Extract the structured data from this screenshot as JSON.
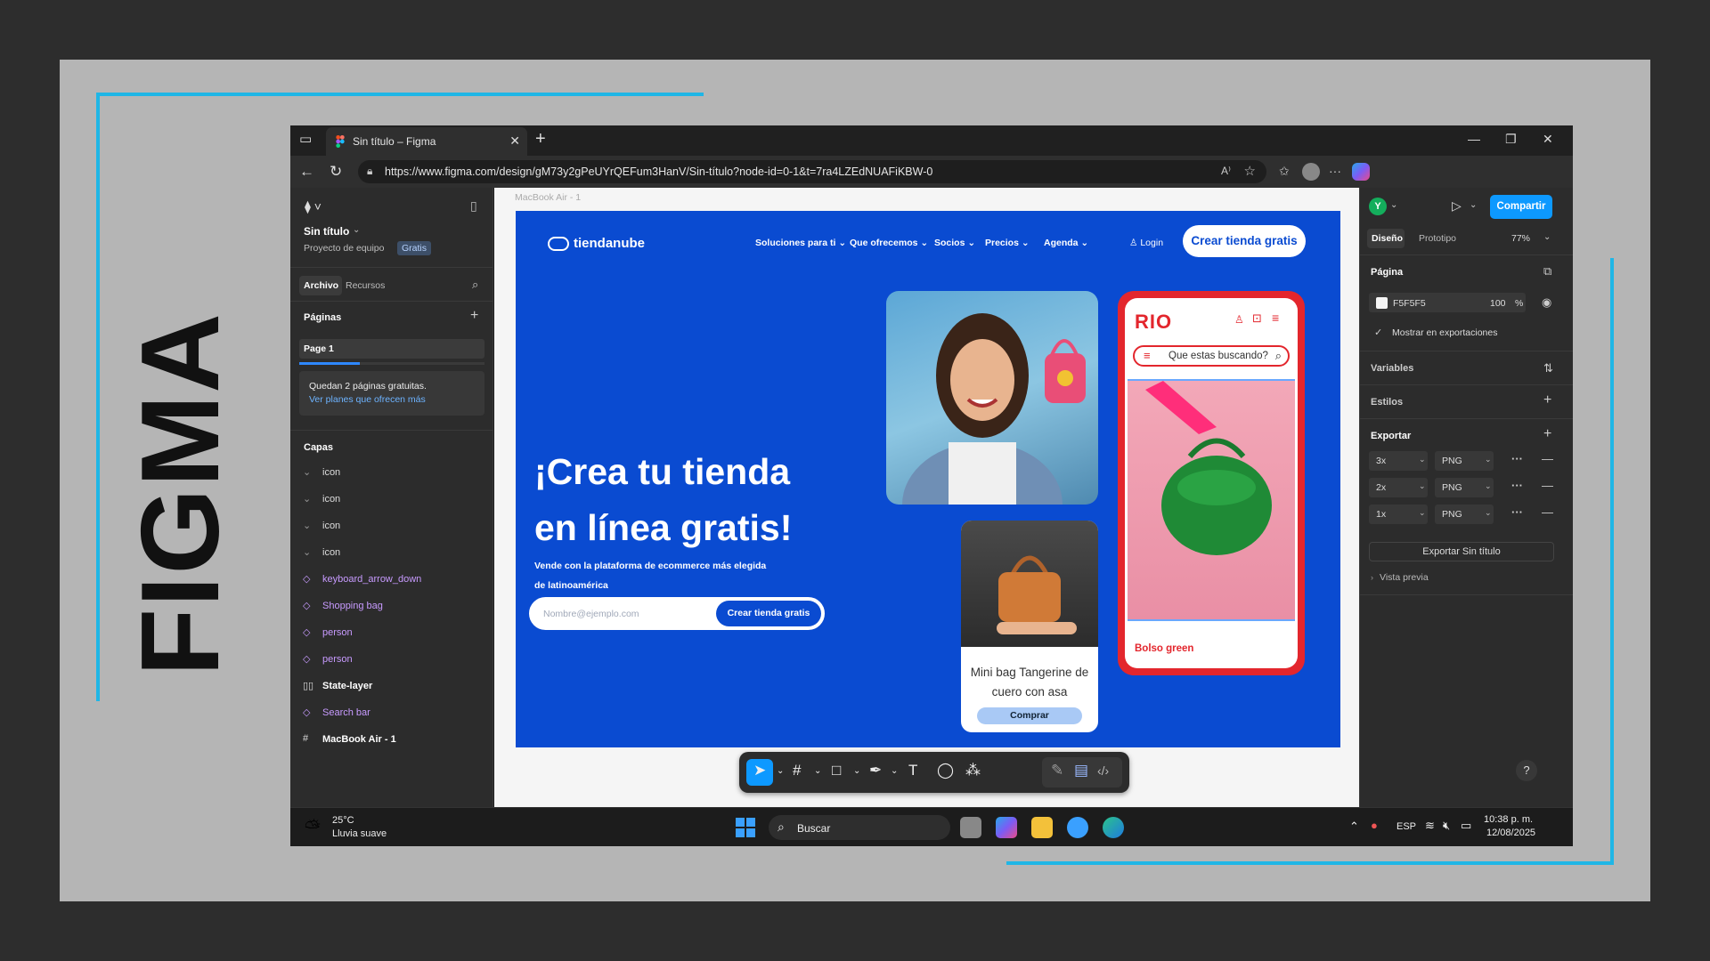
{
  "slide_title": "FIGMA",
  "browser": {
    "tab_title": "Sin título – Figma",
    "url": "https://www.figma.com/design/gM73y2gPeUYrQEFum3HanV/Sin-título?node-id=0-1&t=7ra4LZEdNUAFiKBW-0"
  },
  "left_panel": {
    "file_name": "Sin título",
    "project": "Proyecto de equipo",
    "plan_badge": "Gratis",
    "tabs": [
      "Archivo",
      "Recursos"
    ],
    "pages_heading": "Páginas",
    "page_name": "Page 1",
    "notice_line1": "Quedan 2 páginas gratuitas.",
    "notice_line2": "Ver planes que ofrecen más",
    "layers_heading": "Capas",
    "layers": [
      {
        "name": "icon",
        "kind": "group"
      },
      {
        "name": "icon",
        "kind": "group"
      },
      {
        "name": "icon",
        "kind": "group"
      },
      {
        "name": "icon",
        "kind": "group"
      },
      {
        "name": "keyboard_arrow_down",
        "kind": "component"
      },
      {
        "name": "Shopping bag",
        "kind": "component"
      },
      {
        "name": "person",
        "kind": "component"
      },
      {
        "name": "person",
        "kind": "component"
      },
      {
        "name": "State-layer",
        "kind": "layer"
      },
      {
        "name": "Search bar",
        "kind": "component"
      },
      {
        "name": "MacBook Air - 1",
        "kind": "frame"
      }
    ]
  },
  "canvas": {
    "frame_label": "MacBook Air - 1",
    "design": {
      "brand": "tiendanube",
      "menu": [
        "Soluciones para ti",
        "Que ofrecemos",
        "Socios",
        "Precios",
        "Agenda"
      ],
      "login": "Login",
      "cta_top": "Crear tienda gratis",
      "hero_line1": "¡Crea tu tienda",
      "hero_line2": "en línea gratis!",
      "hero_sub_line1": "Vende con la plataforma de ecommerce más elegida",
      "hero_sub_line2": "de latinoamérica",
      "email_placeholder": "Nombre@ejemplo.com",
      "email_button": "Crear tienda gratis",
      "product_title_line1": "Mini bag Tangerine de",
      "product_title_line2": "cuero con asa",
      "product_button": "Comprar",
      "phone_brand": "RIO",
      "phone_search": "Que estas buscando?",
      "phone_product": "Bolso green"
    }
  },
  "right_panel": {
    "avatar_letter": "Y",
    "share": "Compartir",
    "tabs": [
      "Diseño",
      "Prototipo"
    ],
    "zoom": "77%",
    "page_heading": "Página",
    "page_color": "F5F5F5",
    "page_opacity": "100",
    "percent_sign": "%",
    "show_exports": "Mostrar en exportaciones",
    "variables": "Variables",
    "styles": "Estilos",
    "export_heading": "Exportar",
    "exports": [
      {
        "scale": "3x",
        "format": "PNG"
      },
      {
        "scale": "2x",
        "format": "PNG"
      },
      {
        "scale": "1x",
        "format": "PNG"
      }
    ],
    "export_button": "Exportar Sin título",
    "preview": "Vista previa",
    "help": "?"
  },
  "taskbar": {
    "temperature": "25°C",
    "weather": "Lluvia suave",
    "search": "Buscar",
    "language": "ESP",
    "time": "10:38 p. m.",
    "date": "12/08/2025"
  },
  "colors": {
    "accent_frame": "#1fb6e6",
    "design_blue": "#0a4bd1",
    "figma_blue": "#0d99ff",
    "rio_red": "#e3262d"
  }
}
